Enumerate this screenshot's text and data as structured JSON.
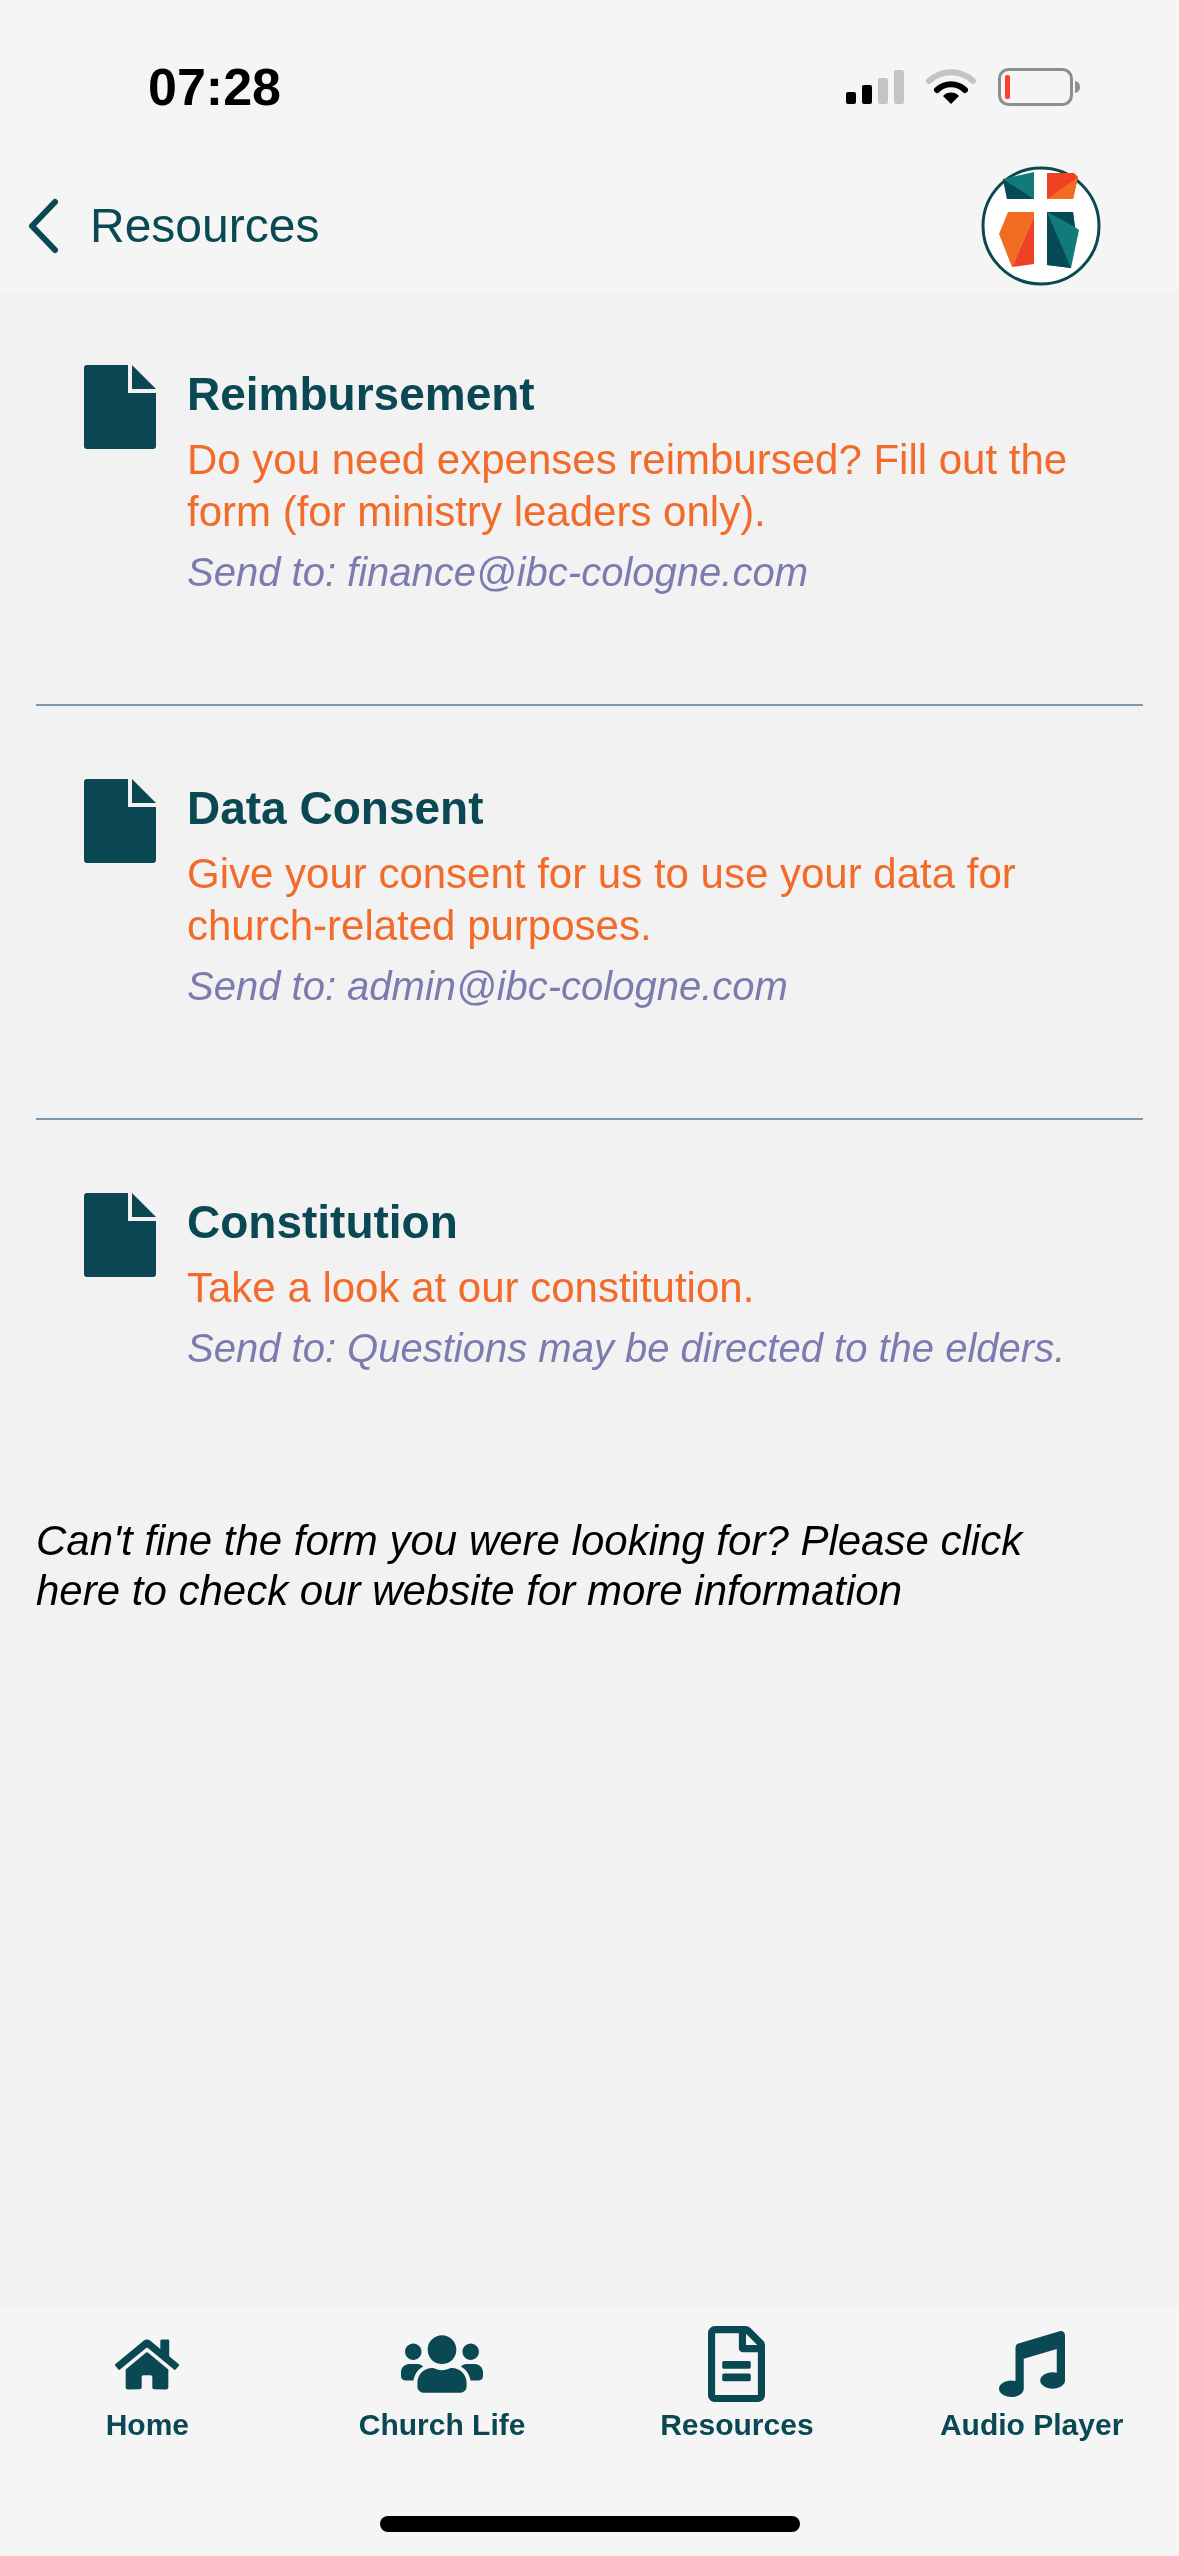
{
  "status_bar": {
    "time": "07:28"
  },
  "header": {
    "back_label": "Resources"
  },
  "resources": [
    {
      "title": "Reimbursement",
      "description": "Do you need expenses reimbursed? Fill out the form (for ministry leaders only).",
      "send_to": "Send to: finance@ibc-cologne.com"
    },
    {
      "title": "Data Consent",
      "description": "Give your consent for us to use your data for church-related purposes.",
      "send_to": "Send to: admin@ibc-cologne.com"
    },
    {
      "title": "Constitution",
      "description": "Take a look at our constitution.",
      "send_to": "Send to: Questions may be directed to the elders."
    }
  ],
  "footer_note": "Can't fine the form you were looking for? Please click here to check our website for more information",
  "tab_bar": [
    {
      "label": "Home",
      "kind": "home"
    },
    {
      "label": "Church Life",
      "kind": "people"
    },
    {
      "label": "Resources",
      "kind": "document"
    },
    {
      "label": "Audio Player",
      "kind": "music"
    }
  ]
}
